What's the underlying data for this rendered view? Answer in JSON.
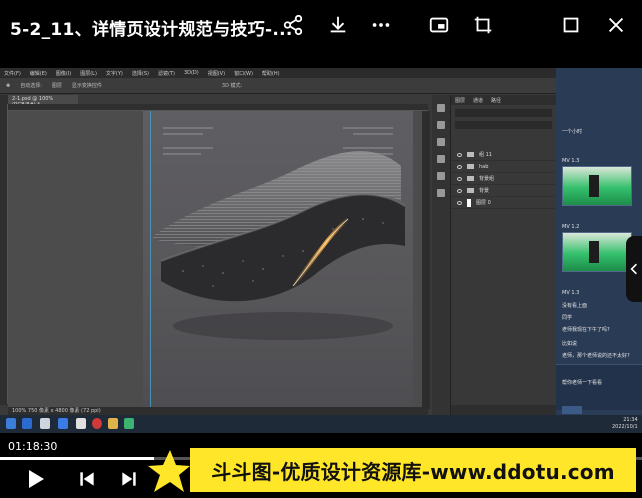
{
  "player": {
    "title": "5-2_11、详情页设计规范与技巧-...",
    "current_time": "01:18:30",
    "progress_fraction": 0.24,
    "icons": [
      "share-icon",
      "download-icon",
      "more-icon",
      "pip-icon",
      "crop-icon",
      "maximize-icon",
      "close-icon",
      "play-icon",
      "prev-icon",
      "next-icon"
    ]
  },
  "photoshop": {
    "menu": [
      "文件(F)",
      "编辑(E)",
      "图像(I)",
      "图层(L)",
      "文字(Y)",
      "选择(S)",
      "滤镜(T)",
      "3D(D)",
      "视图(V)",
      "窗口(W)",
      "帮助(H)"
    ],
    "options_bar": [
      "自动选择:",
      "图层",
      "显示变换控件",
      "3D 模式:"
    ],
    "doc_tab": "2-1.psd @ 100%(RGB/8#) *",
    "status": "100%   750 像素 x 4800 像素 (72 ppi)",
    "layer_tabs": [
      "图层",
      "通道",
      "路径"
    ],
    "layers": [
      {
        "name": "组 11",
        "type": "group"
      },
      {
        "name": "hab",
        "type": "group"
      },
      {
        "name": "背景组",
        "type": "group"
      },
      {
        "name": "背景",
        "type": "group"
      },
      {
        "name": "图层 0",
        "type": "layer"
      }
    ]
  },
  "chat": {
    "messages": [
      "一个小时",
      "MV 1.3",
      "MV 1.2",
      "MV 1.3",
      "没有看上面",
      "同学",
      "老师我现在下午了吗?",
      "比如说",
      "老师，那个老师说的还不太好?",
      "帮你老师一下看看",
      "发送"
    ],
    "clock_time": "21:34",
    "clock_date": "2022/10/1"
  },
  "banner": {
    "text": "斗斗图-优质设计资源库-www.ddotu.com",
    "color": "#ffe628"
  }
}
